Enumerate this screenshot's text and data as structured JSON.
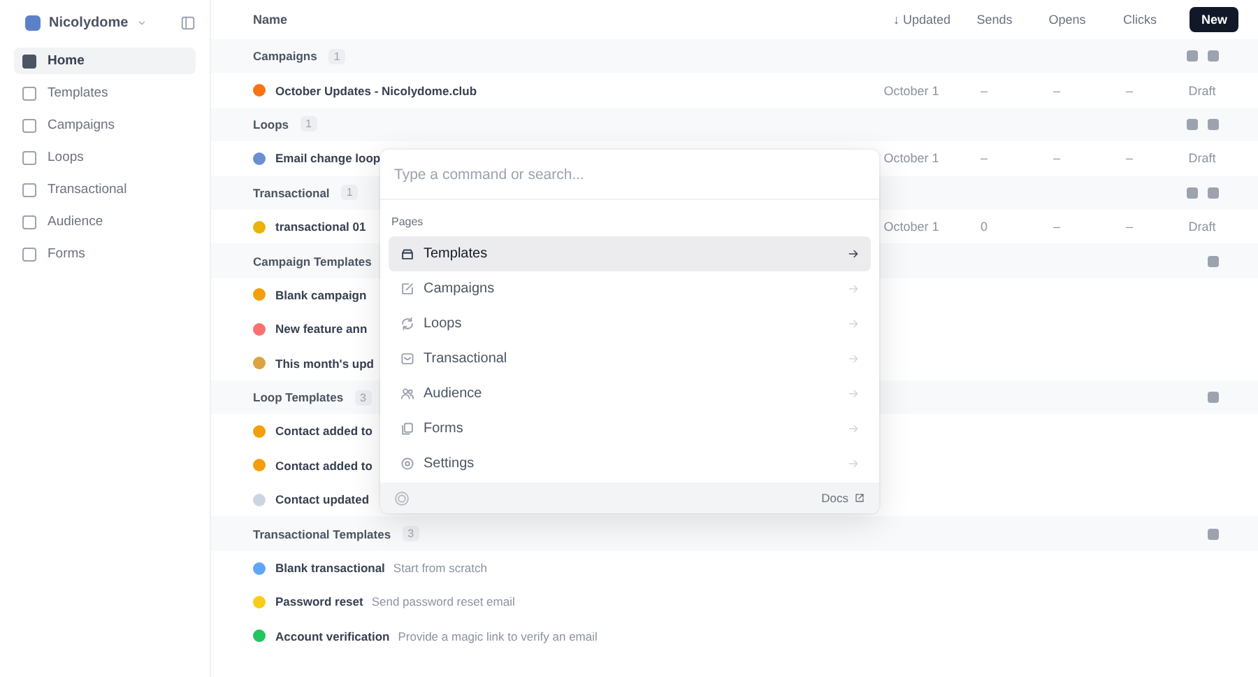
{
  "sidebar": {
    "workspace": "Nicolydome",
    "items": [
      {
        "label": "Home",
        "selected": true
      },
      {
        "label": "Templates",
        "selected": false
      },
      {
        "label": "Campaigns",
        "selected": false
      },
      {
        "label": "Loops",
        "selected": false
      },
      {
        "label": "Transactional",
        "selected": false
      },
      {
        "label": "Audience",
        "selected": false
      },
      {
        "label": "Forms",
        "selected": false
      }
    ]
  },
  "table": {
    "columns": [
      "Name",
      "↓ Updated",
      "Sends",
      "Opens",
      "Clicks"
    ],
    "new_button": "New",
    "sections": [
      {
        "title": "Campaigns",
        "count": "1",
        "kind": "content",
        "rows": [
          {
            "name": "October Updates - Nicolydome.club",
            "updated": "October 1",
            "sends": "–",
            "opens": "–",
            "clicks": "–",
            "status": "Draft",
            "color": "#f97316"
          }
        ]
      },
      {
        "title": "Loops",
        "count": "1",
        "kind": "content",
        "rows": [
          {
            "name": "Email change loop",
            "updated": "October 1",
            "sends": "–",
            "opens": "–",
            "clicks": "–",
            "status": "Draft",
            "color": "#6b8fd6"
          }
        ]
      },
      {
        "title": "Transactional",
        "count": "1",
        "kind": "content",
        "rows": [
          {
            "name": "transactional 01",
            "updated": "October 1",
            "sends": "0",
            "opens": "–",
            "clicks": "–",
            "status": "Draft",
            "color": "#eab308"
          }
        ]
      },
      {
        "title": "Campaign Templates",
        "kind": "templates",
        "rows": [
          {
            "name": "Blank campaign",
            "color": "#f59e0b"
          },
          {
            "name": "New feature ann",
            "color": "#f87171"
          },
          {
            "name": "This month's upd",
            "color": "#d9a441"
          }
        ]
      },
      {
        "title": "Loop Templates",
        "count": "3",
        "kind": "templates",
        "rows": [
          {
            "name": "Contact added to",
            "color": "#f59e0b"
          },
          {
            "name": "Contact added to",
            "color": "#f59e0b"
          },
          {
            "name": "Contact updated",
            "color": "#cbd5e1"
          }
        ]
      },
      {
        "title": "Transactional Templates",
        "count": "3",
        "kind": "templates",
        "rows": [
          {
            "name": "Blank transactional",
            "description": "Start from scratch",
            "color": "#60a5fa"
          },
          {
            "name": "Password reset",
            "description": "Send password reset email",
            "color": "#facc15"
          },
          {
            "name": "Account verification",
            "description": "Provide a magic link to verify an email",
            "color": "#22c55e"
          }
        ]
      }
    ]
  },
  "command_palette": {
    "placeholder": "Type a command or search...",
    "group": "Pages",
    "items": [
      {
        "label": "Templates",
        "selected": true
      },
      {
        "label": "Campaigns",
        "selected": false
      },
      {
        "label": "Loops",
        "selected": false
      },
      {
        "label": "Transactional",
        "selected": false
      },
      {
        "label": "Audience",
        "selected": false
      },
      {
        "label": "Forms",
        "selected": false
      },
      {
        "label": "Settings",
        "selected": false
      }
    ],
    "footer_link": "Docs"
  }
}
